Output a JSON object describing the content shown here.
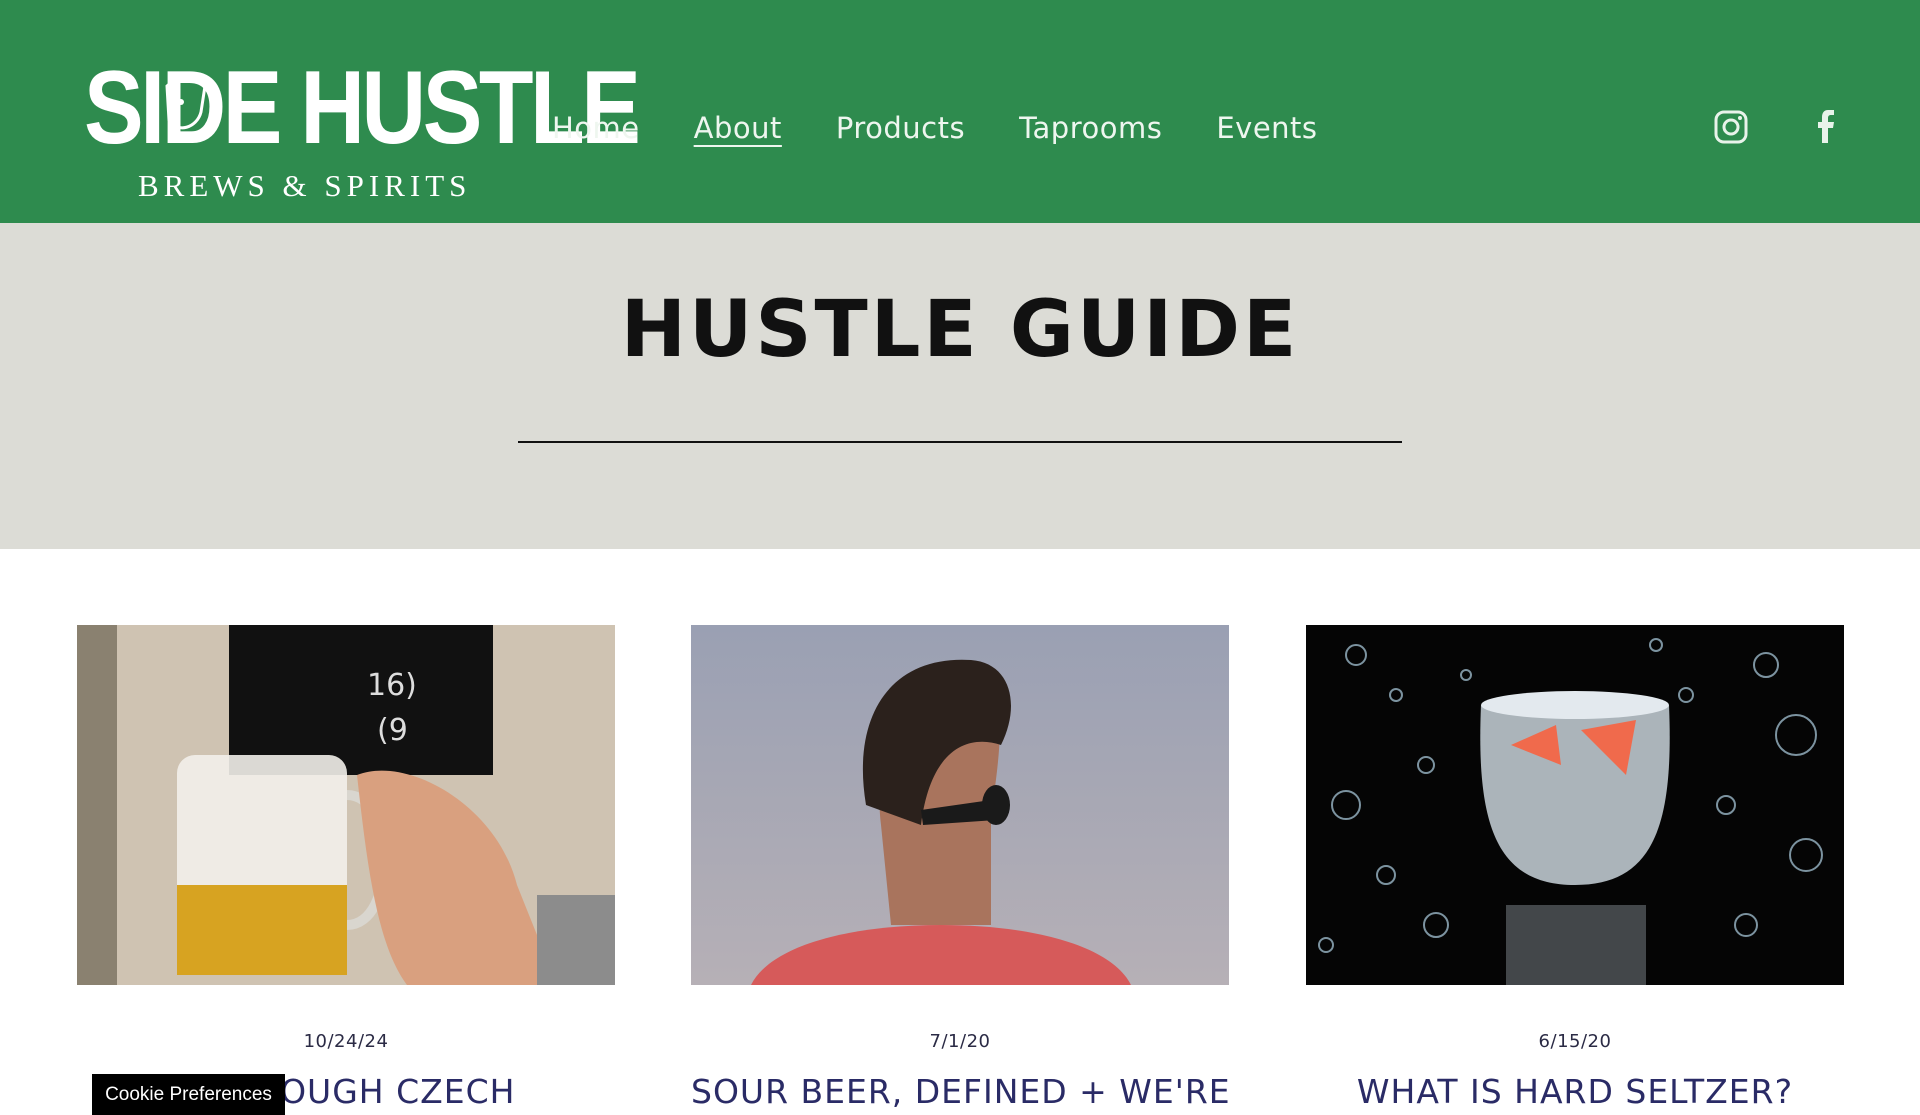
{
  "header": {
    "logo": {
      "main": "SIDE HUSTLE",
      "sub": "BREWS & SPIRITS"
    },
    "nav": [
      {
        "label": "Home"
      },
      {
        "label": "About"
      },
      {
        "label": "Products"
      },
      {
        "label": "Taprooms"
      },
      {
        "label": "Events"
      }
    ],
    "active_nav": "About",
    "social": [
      "instagram-icon",
      "facebook-icon"
    ],
    "background": "#2e8b4e"
  },
  "hero": {
    "title": "HUSTLE GUIDE",
    "background": "#dcdcd6"
  },
  "posts": [
    {
      "date": "10/24/24",
      "title": "Y THROUGH CZECH",
      "image": "beer-mug-photo"
    },
    {
      "date": "7/1/20",
      "title": "SOUR BEER, DEFINED + WE'RE",
      "image": "man-sunglasses-photo"
    },
    {
      "date": "6/15/20",
      "title": "WHAT IS HARD SELTZER?",
      "image": "seltzer-glass-bubbles-photo"
    }
  ],
  "cookie": {
    "label": "Cookie Preferences"
  }
}
